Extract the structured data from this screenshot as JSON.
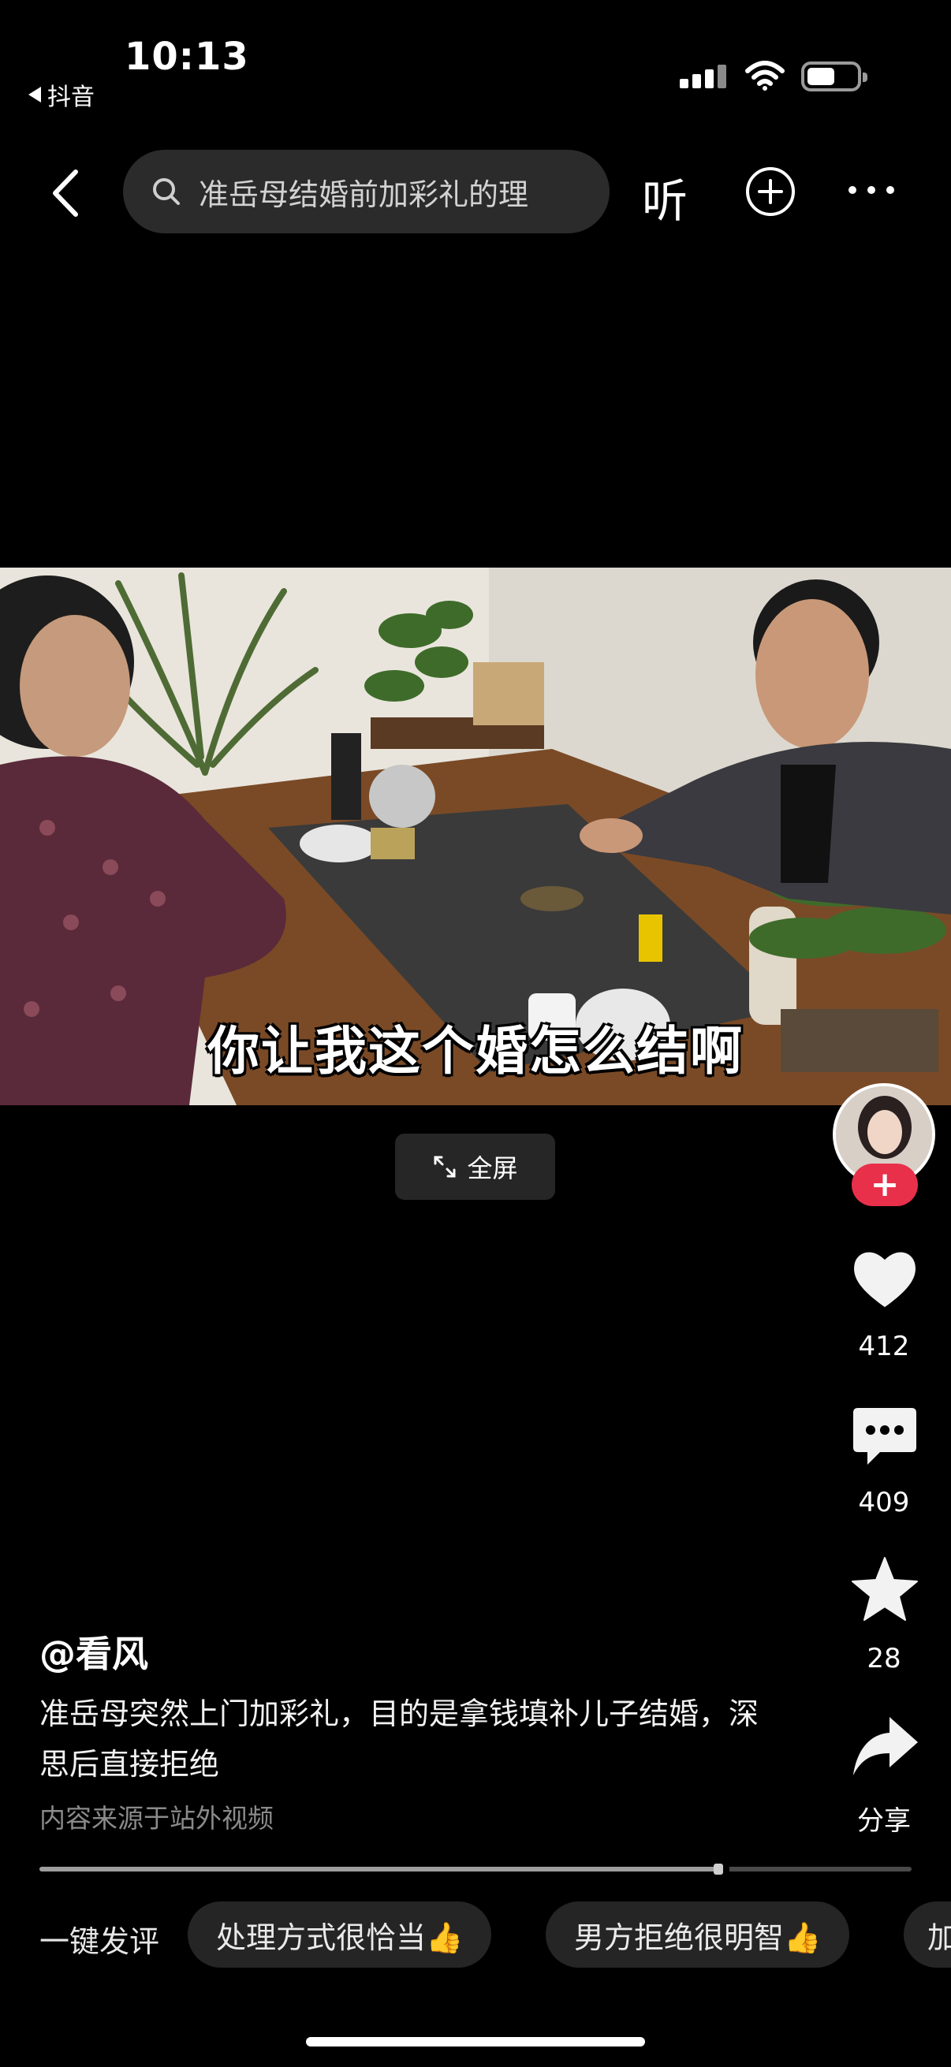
{
  "status": {
    "time": "10:13",
    "back_app": "抖音"
  },
  "nav": {
    "search_text": "准岳母结婚前加彩礼的理",
    "listen_label": "听"
  },
  "video": {
    "subtitle": "你让我这个婚怎么结啊",
    "fullscreen_label": "全屏"
  },
  "actions": {
    "like_count": "412",
    "comment_count": "409",
    "favorite_count": "28",
    "share_label": "分享"
  },
  "post": {
    "author": "@看风",
    "description": "准岳母突然上门加彩礼，目的是拿钱填补儿子结婚，深思后直接拒绝",
    "source_note": "内容来源于站外视频"
  },
  "progress": {
    "fraction": 0.78
  },
  "quick_comment": {
    "label": "一键发评",
    "chips": [
      "处理方式很恰当👍",
      "男方拒绝很明智👍",
      "加"
    ]
  },
  "colors": {
    "background": "#000000",
    "follow_badge": "#e8304b",
    "chip_bg": "#252525"
  }
}
